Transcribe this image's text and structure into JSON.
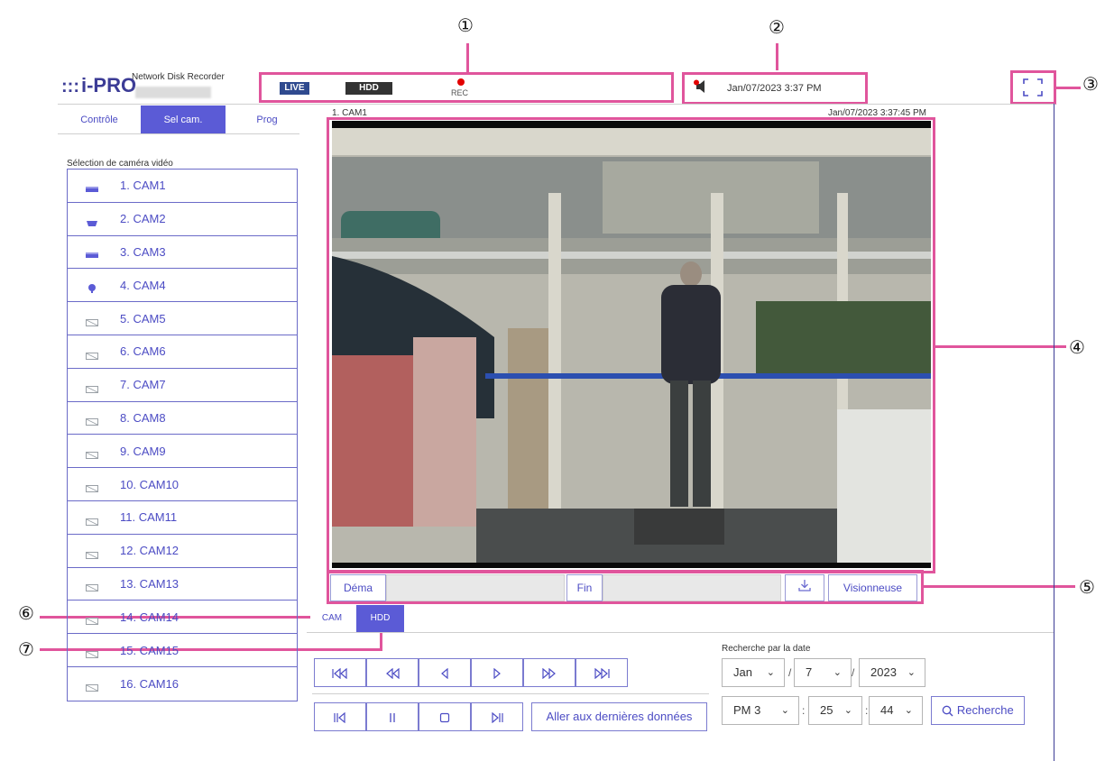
{
  "callouts": [
    "①",
    "②",
    "③",
    "④",
    "⑤",
    "⑥",
    "⑦"
  ],
  "header": {
    "logo": "i-PRO",
    "logo_dots": ":::",
    "product": "Network Disk Recorder",
    "live_badge": "LIVE",
    "hdd_badge": "HDD",
    "rec_label": "REC",
    "datetime": "Jan/07/2023 3:37 PM",
    "colors": {
      "brand": "#3c3c96",
      "accent": "#5b5bd6",
      "callout": "#e0559c",
      "rec": "#e30000"
    }
  },
  "left_tabs": [
    {
      "label": "Contrôle",
      "active": false
    },
    {
      "label": "Sel cam.",
      "active": true
    },
    {
      "label": "Prog",
      "active": false
    }
  ],
  "camera_select": {
    "title": "Sélection de caméra vidéo",
    "cameras": [
      {
        "label": "1. CAM1",
        "icon": "box-camera-icon"
      },
      {
        "label": "2. CAM2",
        "icon": "dome-camera-icon"
      },
      {
        "label": "3. CAM3",
        "icon": "box-camera-icon"
      },
      {
        "label": "4. CAM4",
        "icon": "bullet-camera-icon"
      },
      {
        "label": "5. CAM5",
        "icon": "camera-off-icon"
      },
      {
        "label": "6. CAM6",
        "icon": "camera-off-icon"
      },
      {
        "label": "7. CAM7",
        "icon": "camera-off-icon"
      },
      {
        "label": "8. CAM8",
        "icon": "camera-off-icon"
      },
      {
        "label": "9. CAM9",
        "icon": "camera-off-icon"
      },
      {
        "label": "10. CAM10",
        "icon": "camera-off-icon"
      },
      {
        "label": "11. CAM11",
        "icon": "camera-off-icon"
      },
      {
        "label": "12. CAM12",
        "icon": "camera-off-icon"
      },
      {
        "label": "13. CAM13",
        "icon": "camera-off-icon"
      },
      {
        "label": "14. CAM14",
        "icon": "camera-off-icon"
      },
      {
        "label": "15. CAM15",
        "icon": "camera-off-icon"
      },
      {
        "label": "16. CAM16",
        "icon": "camera-off-icon"
      }
    ]
  },
  "video": {
    "camera_label": "1. CAM1",
    "timestamp": "Jan/07/2023 3:37:45 PM"
  },
  "playback_bar": {
    "start_label": "Déma",
    "end_label": "Fin",
    "download_icon": "download-icon",
    "viewer_label": "Visionneuse"
  },
  "source_tabs": [
    {
      "label": "CAM",
      "active": false
    },
    {
      "label": "HDD",
      "active": true
    }
  ],
  "controls": {
    "row1": [
      "skip-to-start-icon",
      "fast-rewind-icon",
      "reverse-play-icon",
      "play-icon",
      "fast-forward-icon",
      "skip-to-end-icon"
    ],
    "row2": [
      "previous-frame-icon",
      "pause-icon",
      "stop-icon",
      "next-frame-icon"
    ],
    "latest_label": "Aller aux dernières données"
  },
  "date_search": {
    "title": "Recherche par la date",
    "month": "Jan",
    "day": "7",
    "year": "2023",
    "hour": "PM 3",
    "minute": "25",
    "second": "44",
    "search_label": "Recherche"
  }
}
